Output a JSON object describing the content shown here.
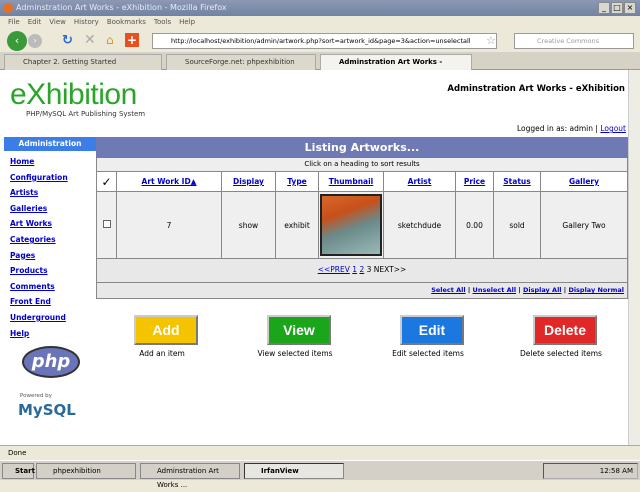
{
  "window": {
    "title": "Adminstration Art Works - eXhibition - Mozilla Firefox"
  },
  "menu": [
    "File",
    "Edit",
    "View",
    "History",
    "Bookmarks",
    "Tools",
    "Help"
  ],
  "url": "http://localhost/exhibition/admin/artwork.php?sort=artwork_id&page=3&action=unselectall",
  "search_placeholder": "Creative Commons",
  "tabs": [
    "Chapter 2. Getting Started",
    "SourceForge.net: phpexhibition Project...",
    "Adminstration Art Works - eXhibi..."
  ],
  "site": {
    "logo": "eXhibition",
    "tagline": "PHP/MySQL Art Publishing System",
    "heading": "Adminstration Art Works - eXhibition",
    "logged_in": "Logged in as: admin |",
    "logout": "Logout"
  },
  "sidebar": {
    "title": "Administration",
    "items": [
      "Home",
      "Configuration",
      "Artists",
      "Galleries",
      "Art Works",
      "Categories",
      "Pages",
      "Products",
      "Comments",
      "Front End",
      "Underground",
      "Help"
    ],
    "php_logo": "php",
    "mysql_logo": "MySQL",
    "powered_by": "Powered by"
  },
  "listing": {
    "title": "Listing Artworks...",
    "hint": "Click on a heading to sort results",
    "columns": [
      "✓",
      "Art Work ID▲",
      "Display",
      "Type",
      "Thumbnail",
      "Artist",
      "Price",
      "Status",
      "Gallery"
    ],
    "rows": [
      {
        "id": "7",
        "display": "show",
        "type": "exhibit",
        "artist": "sketchdude",
        "price": "0.00",
        "status": "sold",
        "gallery": "Gallery Two"
      }
    ],
    "pager": {
      "prev": "<<PREV",
      "p1": "1",
      "p2": "2",
      "current": "3",
      "next": "NEXT>>"
    },
    "select_links": [
      "Select All",
      "Unselect All",
      "Display All",
      "Display Normal"
    ]
  },
  "actions": [
    {
      "label": "Add",
      "desc": "Add an item",
      "color": "#f5c400"
    },
    {
      "label": "View",
      "desc": "View selected items",
      "color": "#1aa51a"
    },
    {
      "label": "Edit",
      "desc": "Edit selected items",
      "color": "#1a78e0"
    },
    {
      "label": "Delete",
      "desc": "Delete selected items",
      "color": "#e02828"
    }
  ],
  "status": "Done",
  "taskbar": {
    "start": "Start",
    "items": [
      "phpexhibition",
      "Adminstration Art Works ...",
      "IrfanView"
    ],
    "clock": "12:58 AM"
  }
}
